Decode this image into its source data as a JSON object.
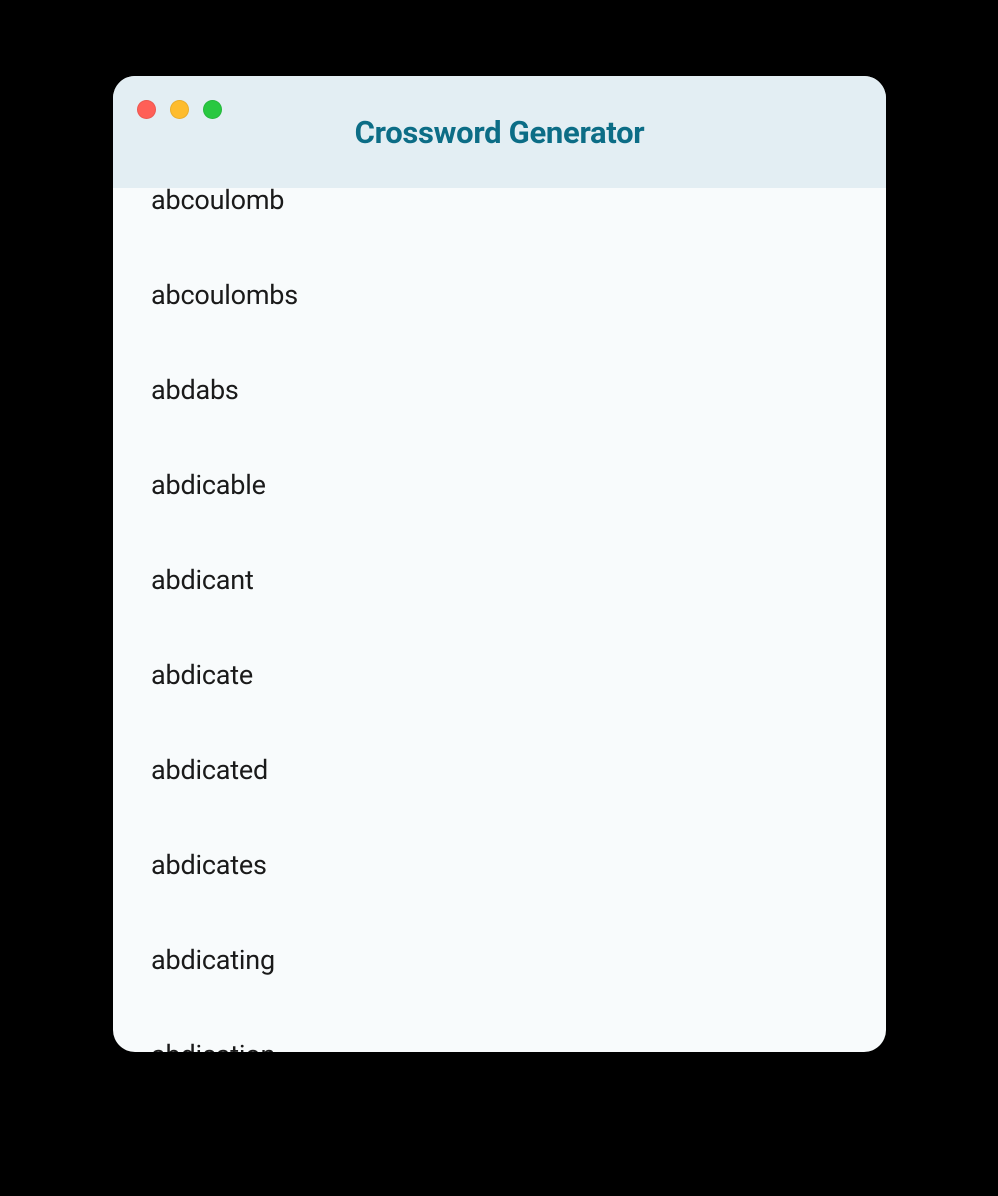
{
  "app": {
    "title": "Crossword Generator"
  },
  "wordList": {
    "items": [
      "abcoulomb",
      "abcoulombs",
      "abdabs",
      "abdicable",
      "abdicant",
      "abdicate",
      "abdicated",
      "abdicates",
      "abdicating",
      "abdication"
    ]
  }
}
